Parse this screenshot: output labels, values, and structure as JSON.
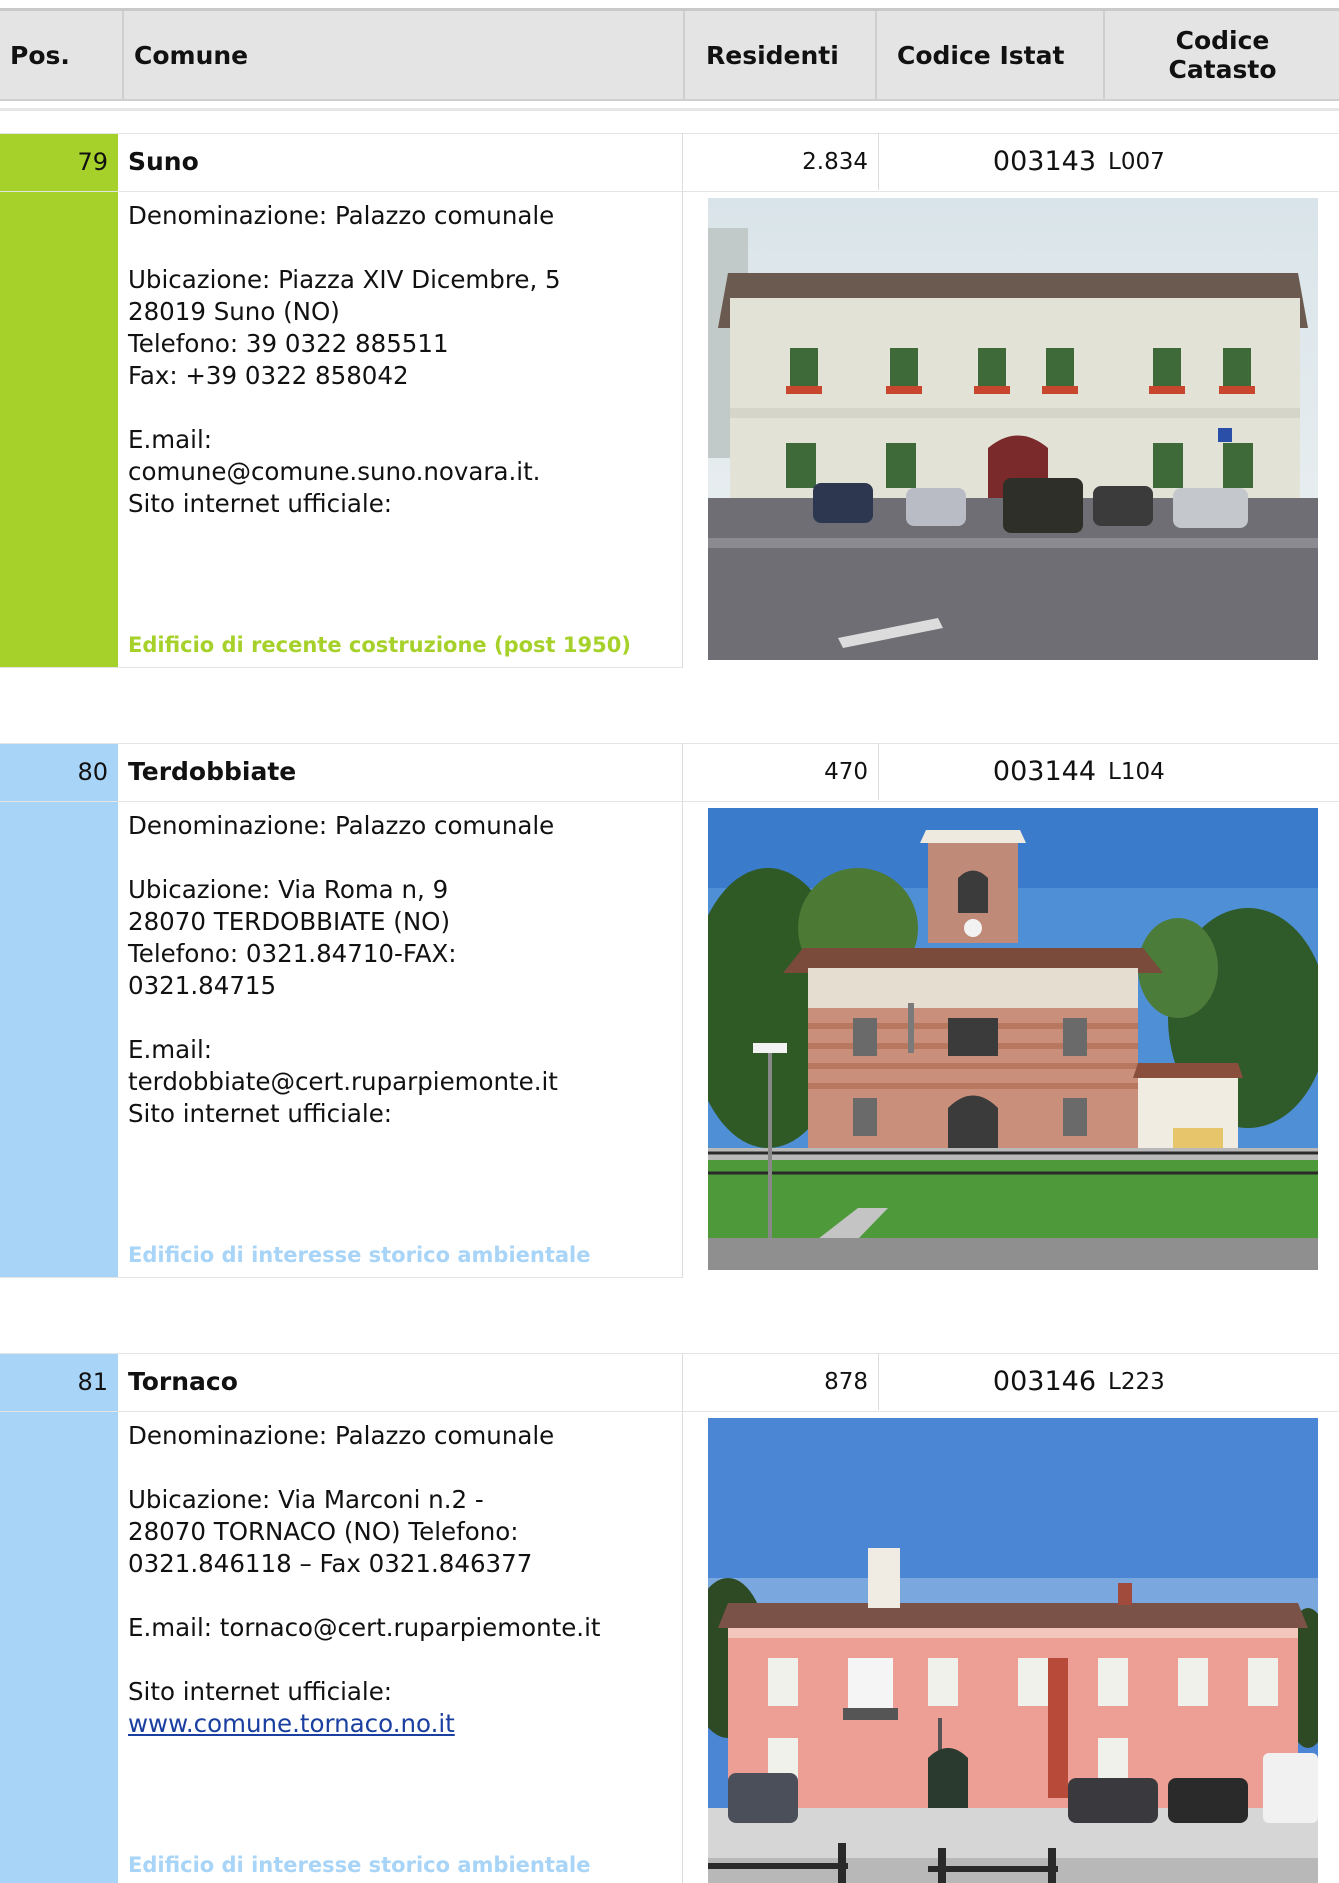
{
  "header": {
    "pos": "Pos.",
    "comune": "Comune",
    "residenti": "Residenti",
    "codice_istat": "Codice Istat",
    "codice_catasto_1": "Codice",
    "codice_catasto_2": "Catasto"
  },
  "colors": {
    "green": "#a6d12a",
    "blue": "#a7d4f7",
    "link": "#1a3fa0"
  },
  "entries": [
    {
      "pos": "79",
      "name": "Suno",
      "residenti": "2.834",
      "istat": "003143",
      "catasto": "L007",
      "denominazione": "Denominazione: Palazzo comunale",
      "ubicazione": [
        "Ubicazione: Piazza XIV Dicembre, 5",
        "28019 Suno (NO)",
        "Telefono: 39 0322 885511",
        "Fax: +39 0322 858042"
      ],
      "email": [
        "E.mail:",
        "comune@comune.suno.novara.it."
      ],
      "sito": "Sito internet ufficiale:",
      "note": "Edificio di recente costruzione (post 1950)",
      "photo": "town-hall-photo-suno"
    },
    {
      "pos": "80",
      "name": "Terdobbiate",
      "residenti": "470",
      "istat": "003144",
      "catasto": "L104",
      "denominazione": "Denominazione: Palazzo comunale",
      "ubicazione": [
        "Ubicazione: Via Roma n, 9",
        "28070 TERDOBBIATE (NO)",
        "Telefono: 0321.84710-FAX:",
        "0321.84715"
      ],
      "email": [
        "E.mail:",
        "terdobbiate@cert.ruparpiemonte.it"
      ],
      "sito": "Sito internet ufficiale:",
      "note": "Edificio di interesse storico ambientale",
      "photo": "town-hall-photo-terdobbiate"
    },
    {
      "pos": "81",
      "name": "Tornaco",
      "residenti": "878",
      "istat": "003146",
      "catasto": "L223",
      "denominazione": "Denominazione: Palazzo comunale",
      "ubicazione": [
        "Ubicazione: Via Marconi n.2 -",
        "28070 TORNACO (NO) Telefono:",
        "0321.846118 – Fax 0321.846377"
      ],
      "email": [
        "E.mail: tornaco@cert.ruparpiemonte.it"
      ],
      "sito": "Sito internet ufficiale:",
      "sito_link": "www.comune.tornaco.no.it",
      "note": "Edificio di interesse storico ambientale",
      "photo": "town-hall-photo-tornaco"
    }
  ]
}
